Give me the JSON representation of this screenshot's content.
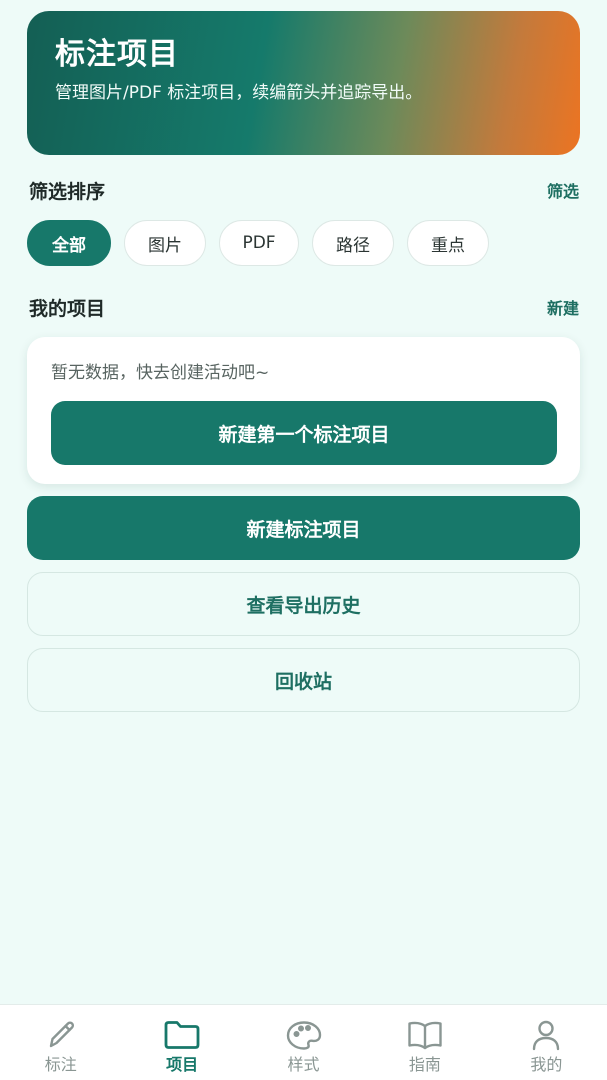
{
  "hero": {
    "title": "标注项目",
    "subtitle": "管理图片/PDF 标注项目，续编箭头并追踪导出。"
  },
  "filter": {
    "title": "筛选排序",
    "action": "筛选",
    "chips": [
      {
        "label": "全部",
        "active": true
      },
      {
        "label": "图片",
        "active": false
      },
      {
        "label": "PDF",
        "active": false
      },
      {
        "label": "路径",
        "active": false
      },
      {
        "label": "重点",
        "active": false
      }
    ]
  },
  "projects": {
    "title": "我的项目",
    "action": "新建",
    "empty_text": "暂无数据，快去创建活动吧~",
    "empty_button": "新建第一个标注项目"
  },
  "actions": {
    "new_project": "新建标注项目",
    "export_history": "查看导出历史",
    "recycle_bin": "回收站"
  },
  "tabbar": {
    "items": [
      {
        "label": "标注",
        "icon": "pencil-icon",
        "active": false
      },
      {
        "label": "项目",
        "icon": "folder-icon",
        "active": true
      },
      {
        "label": "样式",
        "icon": "palette-icon",
        "active": false
      },
      {
        "label": "指南",
        "icon": "book-icon",
        "active": false
      },
      {
        "label": "我的",
        "icon": "person-icon",
        "active": false
      }
    ]
  },
  "colors": {
    "accent": "#17786a",
    "background": "#eefbf8",
    "gradient_start": "#145f54",
    "gradient_end": "#ec7422"
  }
}
